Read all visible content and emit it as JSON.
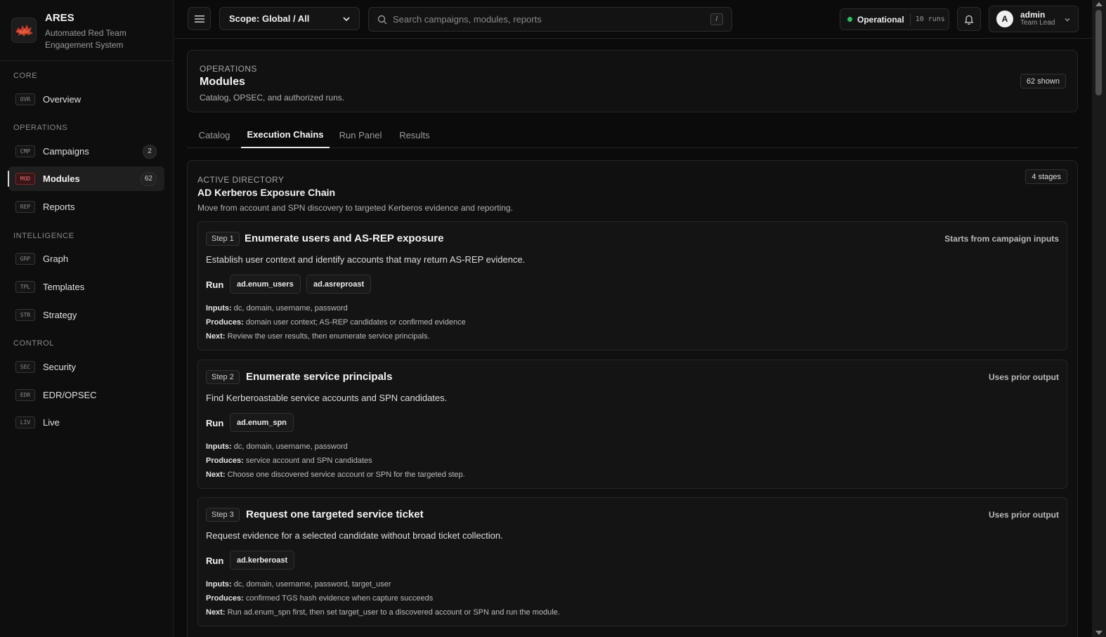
{
  "brand": {
    "name": "ARES",
    "subtitle": "Automated Red Team Engagement System"
  },
  "sidebar": {
    "sections": [
      {
        "label": "CORE"
      },
      {
        "label": "OPERATIONS"
      },
      {
        "label": "INTELLIGENCE"
      },
      {
        "label": "CONTROL"
      }
    ],
    "items": [
      {
        "code": "OVR",
        "label": "Overview"
      },
      {
        "code": "CMP",
        "label": "Campaigns",
        "count": "2"
      },
      {
        "code": "MOD",
        "label": "Modules",
        "count": "62",
        "active": true
      },
      {
        "code": "REP",
        "label": "Reports"
      },
      {
        "code": "GRP",
        "label": "Graph"
      },
      {
        "code": "TPL",
        "label": "Templates"
      },
      {
        "code": "STR",
        "label": "Strategy"
      },
      {
        "code": "SEC",
        "label": "Security"
      },
      {
        "code": "EDR",
        "label": "EDR/OPSEC"
      },
      {
        "code": "LIV",
        "label": "Live"
      }
    ]
  },
  "topbar": {
    "scope_label": "Scope: Global / All",
    "search_placeholder": "Search campaigns, modules, reports",
    "search_shortcut": "/",
    "status_label": "Operational",
    "status_runs": "10 runs",
    "status_color": "#22c55e",
    "user_initial": "A",
    "user_name": "admin",
    "user_role": "Team Lead"
  },
  "page": {
    "eyebrow": "OPERATIONS",
    "title": "Modules",
    "subtitle": "Catalog, OPSEC, and authorized runs.",
    "shown_badge": "62 shown"
  },
  "tabs": [
    {
      "label": "Catalog"
    },
    {
      "label": "Execution Chains",
      "active": true
    },
    {
      "label": "Run Panel"
    },
    {
      "label": "Results"
    }
  ],
  "chain": {
    "eyebrow": "ACTIVE DIRECTORY",
    "title": "AD Kerberos Exposure Chain",
    "description": "Move from account and SPN discovery to targeted Kerberos evidence and reporting.",
    "stages_badge": "4 stages",
    "run_label": "Run",
    "inputs_label": "Inputs:",
    "produces_label": "Produces:",
    "next_label": "Next:",
    "steps": [
      {
        "badge": "Step 1",
        "title": "Enumerate users and AS-REP exposure",
        "flow": "Starts from campaign inputs",
        "description": "Establish user context and identify accounts that may return AS-REP evidence.",
        "modules": [
          "ad.enum_users",
          "ad.asreproast"
        ],
        "inputs": "dc, domain, username, password",
        "produces": "domain user context; AS-REP candidates or confirmed evidence",
        "next": "Review the user results, then enumerate service principals."
      },
      {
        "badge": "Step 2",
        "title": "Enumerate service principals",
        "flow": "Uses prior output",
        "description": "Find Kerberoastable service accounts and SPN candidates.",
        "modules": [
          "ad.enum_spn"
        ],
        "inputs": "dc, domain, username, password",
        "produces": "service account and SPN candidates",
        "next": "Choose one discovered service account or SPN for the targeted step."
      },
      {
        "badge": "Step 3",
        "title": "Request one targeted service ticket",
        "flow": "Uses prior output",
        "description": "Request evidence for a selected candidate without broad ticket collection.",
        "modules": [
          "ad.kerberoast"
        ],
        "inputs": "dc, domain, username, password, target_user",
        "produces": "confirmed TGS hash evidence when capture succeeds",
        "next": "Run ad.enum_spn first, then set target_user to a discovered account or SPN and run the module."
      }
    ]
  }
}
